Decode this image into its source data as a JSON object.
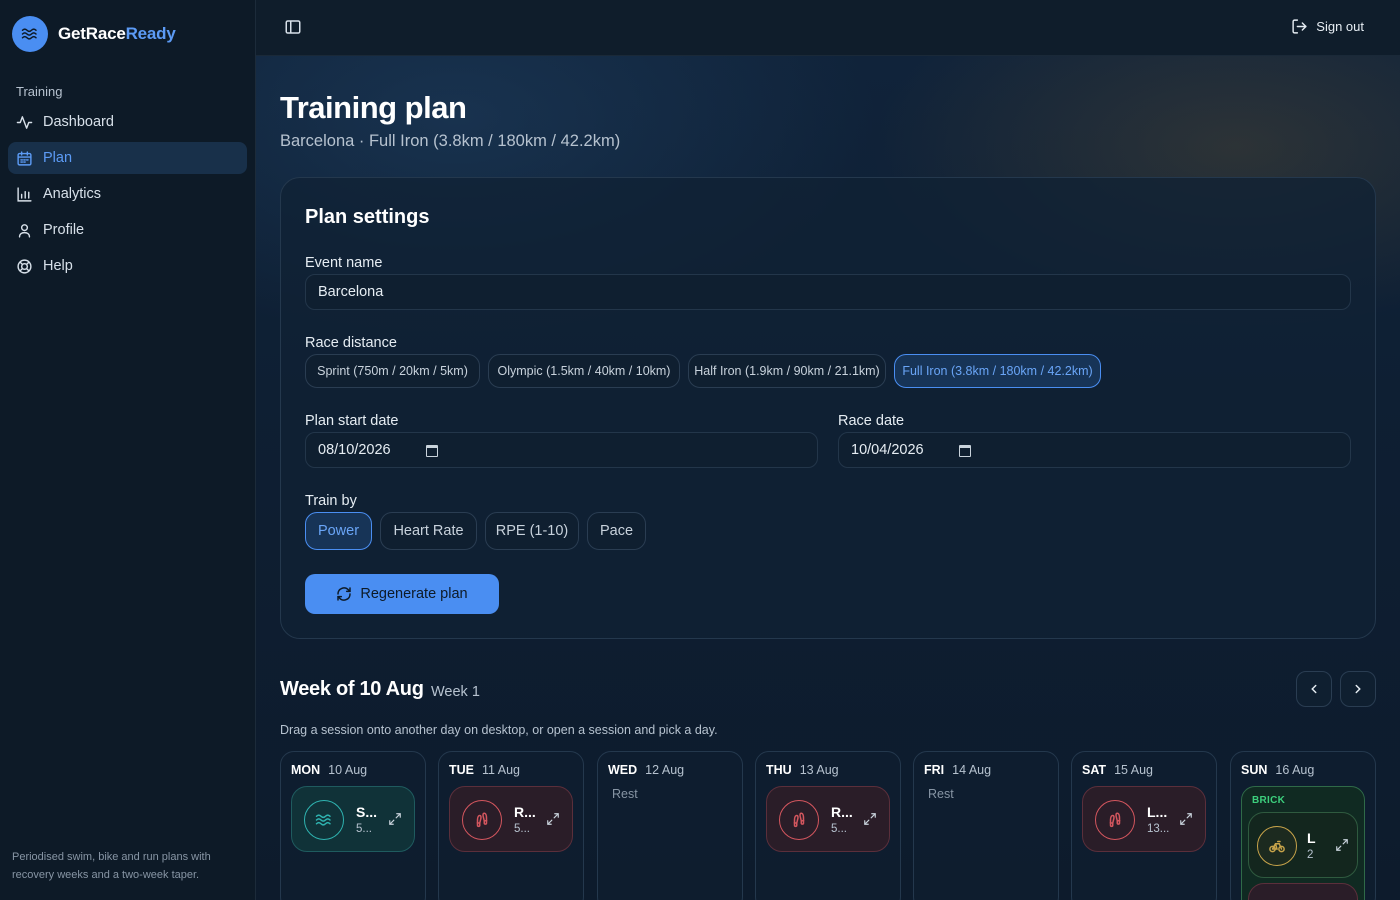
{
  "app": {
    "brand_first": "GetRace",
    "brand_accent": "Ready",
    "accent_color": "#4a8ef2"
  },
  "sidebar": {
    "section_label": "Training",
    "items": [
      {
        "label": "Dashboard",
        "icon": "activity-icon"
      },
      {
        "label": "Plan",
        "icon": "calendar-icon",
        "active": true
      },
      {
        "label": "Analytics",
        "icon": "bar-chart-icon"
      },
      {
        "label": "Profile",
        "icon": "user-icon"
      },
      {
        "label": "Help",
        "icon": "lifebuoy-icon"
      }
    ],
    "footer": "Periodised swim, bike and run plans with recovery weeks and a two-week taper."
  },
  "topbar": {
    "signout_label": "Sign out"
  },
  "page": {
    "title": "Training plan",
    "subtitle": "Barcelona · Full Iron (3.8km / 180km / 42.2km)"
  },
  "settings": {
    "title": "Plan settings",
    "event_name_label": "Event name",
    "event_name_value": "Barcelona",
    "race_distance_label": "Race distance",
    "distances": [
      "Sprint (750m / 20km / 5km)",
      "Olympic (1.5km / 40km / 10km)",
      "Half Iron (1.9km / 90km / 21.1km)",
      "Full Iron (3.8km / 180km / 42.2km)"
    ],
    "selected_distance": "Full Iron (3.8km / 180km / 42.2km)",
    "start_date_label": "Plan start date",
    "start_date_value": "08/10/2026",
    "race_date_label": "Race date",
    "race_date_value": "10/04/2026",
    "train_by_label": "Train by",
    "train_by_options": [
      "Power",
      "Heart Rate",
      "RPE (1-10)",
      "Pace"
    ],
    "train_by_selected": "Power",
    "regenerate_label": "Regenerate plan"
  },
  "week": {
    "title": "Week of 10 Aug",
    "subtitle": "Week 1",
    "hint": "Drag a session onto another day on desktop, or open a session and pick a day.",
    "days": [
      {
        "name": "MON",
        "date": "10 Aug",
        "session": {
          "type": "swim",
          "title": "S...",
          "sub": "5..."
        }
      },
      {
        "name": "TUE",
        "date": "11 Aug",
        "session": {
          "type": "run",
          "title": "R...",
          "sub": "5..."
        }
      },
      {
        "name": "WED",
        "date": "12 Aug",
        "rest": "Rest"
      },
      {
        "name": "THU",
        "date": "13 Aug",
        "session": {
          "type": "run",
          "title": "R...",
          "sub": "5..."
        }
      },
      {
        "name": "FRI",
        "date": "14 Aug",
        "rest": "Rest"
      },
      {
        "name": "SAT",
        "date": "15 Aug",
        "session": {
          "type": "run",
          "title": "L...",
          "sub": "13..."
        }
      },
      {
        "name": "SUN",
        "date": "16 Aug",
        "brick": {
          "label": "BRICK",
          "session": {
            "type": "bike",
            "title": "L",
            "sub": "2"
          }
        }
      }
    ]
  }
}
